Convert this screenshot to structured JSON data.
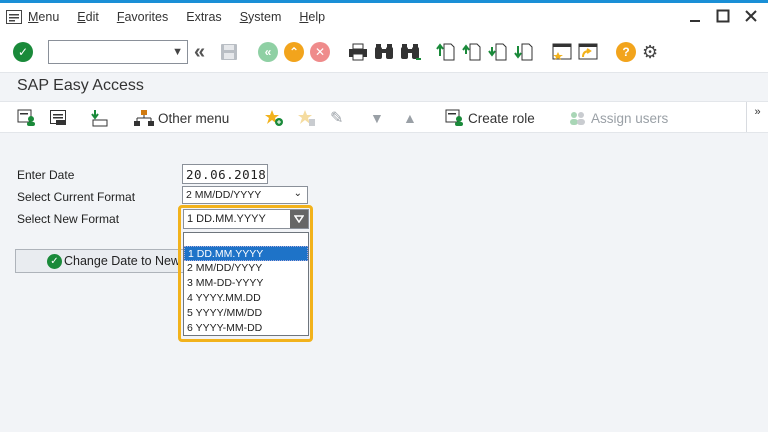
{
  "menu": {
    "items": [
      {
        "u": "M",
        "rest": "enu"
      },
      {
        "u": "E",
        "rest": "dit"
      },
      {
        "u": "F",
        "rest": "avorites"
      },
      {
        "u": "",
        "pre": "Extr",
        "rest": "as"
      },
      {
        "u": "S",
        "rest": "ystem"
      },
      {
        "u": "H",
        "rest": "elp"
      }
    ]
  },
  "toolbar": {
    "command_field_value": ""
  },
  "title": "SAP Easy Access",
  "app_toolbar": {
    "other_menu": "Other menu",
    "create_role": "Create role",
    "assign_users": "Assign users",
    "more": "»"
  },
  "form": {
    "enter_date_label": "Enter Date",
    "enter_date_value": "20.06.2018",
    "current_format_label": "Select Current Format",
    "current_format_value": "2 MM/DD/YYYY",
    "new_format_label": "Select New Format",
    "new_format_value": "1 DD.MM.YYYY",
    "execute_button": "Change Date to New Format",
    "options": [
      "1 DD.MM.YYYY",
      "2 MM/DD/YYYY",
      "3 MM-DD-YYYY",
      "4 YYYY.MM.DD",
      "5 YYYY/MM/DD",
      "6 YYYY-MM-DD"
    ],
    "selected_option_index": 0
  },
  "colors": {
    "highlight": "#f2b21c",
    "selection": "#1e73c8",
    "accent_green": "#1a8a3a"
  }
}
